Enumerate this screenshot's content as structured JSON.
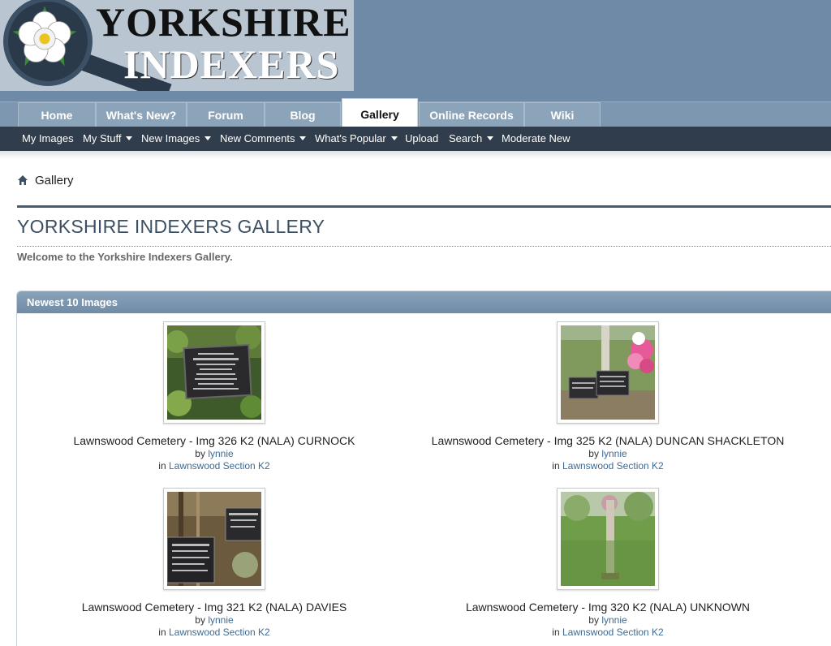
{
  "header": {
    "logo_line1": "YORKSHIRE",
    "logo_line2": "INDEXERS"
  },
  "tabs": [
    {
      "label": "Home"
    },
    {
      "label": "What's New?"
    },
    {
      "label": "Forum"
    },
    {
      "label": "Blog"
    },
    {
      "label": "Gallery",
      "active": true
    },
    {
      "label": "Online Records"
    },
    {
      "label": "Wiki"
    }
  ],
  "subnav": [
    {
      "label": "My Images",
      "dropdown": false
    },
    {
      "label": "My Stuff",
      "dropdown": true
    },
    {
      "label": "New Images",
      "dropdown": true
    },
    {
      "label": "New Comments",
      "dropdown": true
    },
    {
      "label": "What's Popular",
      "dropdown": true
    },
    {
      "label": "Upload",
      "dropdown": false
    },
    {
      "label": "Search",
      "dropdown": true
    },
    {
      "label": "Moderate New",
      "dropdown": false
    }
  ],
  "breadcrumb": {
    "icon": "home-icon",
    "label": "Gallery"
  },
  "page": {
    "title": "YORKSHIRE INDEXERS GALLERY",
    "welcome": "Welcome to the Yorkshire Indexers Gallery."
  },
  "panel": {
    "title": "Newest 10 Images",
    "by_prefix": "by",
    "in_prefix": "in",
    "items": [
      {
        "title": "Lawnswood Cemetery - Img 326 K2 (NALA) CURNOCK",
        "author": "lynnie",
        "album": "Lawnswood Section K2"
      },
      {
        "title": "Lawnswood Cemetery - Img 325 K2 (NALA) DUNCAN SHACKLETON",
        "author": "lynnie",
        "album": "Lawnswood Section K2"
      },
      {
        "title": "Lawnswood Cemetery - Img 321 K2 (NALA) DAVIES",
        "author": "lynnie",
        "album": "Lawnswood Section K2"
      },
      {
        "title": "Lawnswood Cemetery - Img 320 K2 (NALA) UNKNOWN",
        "author": "lynnie",
        "album": "Lawnswood Section K2"
      }
    ]
  },
  "colors": {
    "header_bg": "#6e8aa6",
    "subnav_bg": "#2f3d4c",
    "title_color": "#3c4f63",
    "link_color": "#3e6a93"
  }
}
